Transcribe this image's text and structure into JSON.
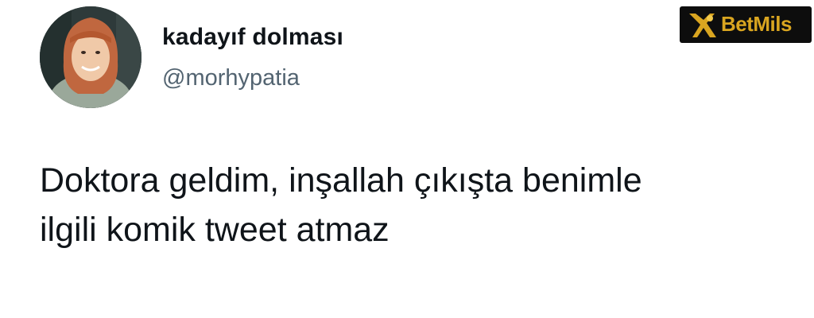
{
  "tweet": {
    "author": {
      "display_name": "kadayıf dolması",
      "handle": "@morhypatia",
      "avatar_icon": "profile-photo"
    },
    "text_lines": [
      "Doktora geldim, inşallah çıkışta benimle",
      "ilgili komik tweet atmaz"
    ]
  },
  "watermark": {
    "brand": "BetMils",
    "colors": {
      "background": "#0d0d0d",
      "gold": "#d9a520"
    }
  }
}
